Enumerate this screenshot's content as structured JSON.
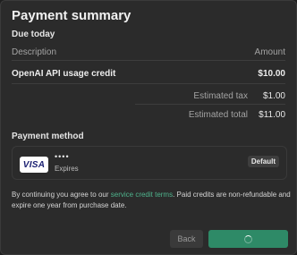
{
  "dialog": {
    "title": "Payment summary",
    "due_today_label": "Due today"
  },
  "table": {
    "col_description": "Description",
    "col_amount": "Amount",
    "item": {
      "description": "OpenAI API usage credit",
      "amount": "$10.00"
    }
  },
  "summary": {
    "tax_label": "Estimated tax",
    "tax_amount": "$1.00",
    "total_label": "Estimated total",
    "total_amount": "$11.00"
  },
  "payment": {
    "section_label": "Payment method",
    "card_brand": "VISA",
    "card_number_masked": "••••",
    "expires_label": "Expires",
    "default_badge": "Default"
  },
  "terms": {
    "prefix": "By continuing you agree to our ",
    "link": "service credit terms",
    "suffix": ". Paid credits are non-refundable and expire one year from purchase date."
  },
  "actions": {
    "back_label": "Back"
  },
  "colors": {
    "accent": "#2e8a67",
    "link": "#4eb38c",
    "background": "#2b2b2b"
  }
}
